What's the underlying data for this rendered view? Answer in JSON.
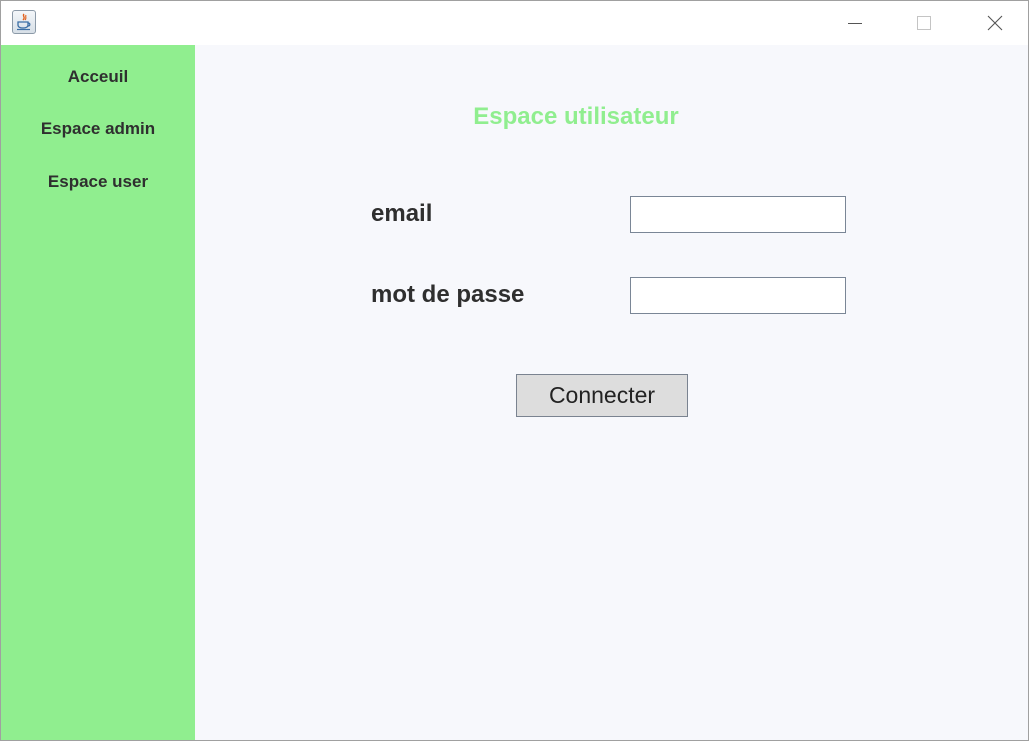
{
  "window": {
    "app_icon": "java-coffee-cup-icon",
    "controls": [
      "minimize-icon",
      "maximize-icon",
      "close-icon"
    ]
  },
  "sidebar": {
    "background": "#90ee8f",
    "items": [
      {
        "label": "Acceuil"
      },
      {
        "label": "Espace admin"
      },
      {
        "label": "Espace user"
      }
    ]
  },
  "main": {
    "title": "Espace utilisateur",
    "title_color": "#90ee8f",
    "form": {
      "email_label": "email",
      "email_value": "",
      "password_label": "mot de passe",
      "password_value": "",
      "submit_label": "Connecter"
    }
  }
}
